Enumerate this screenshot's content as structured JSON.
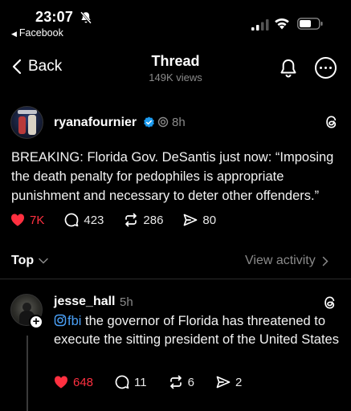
{
  "status_bar": {
    "time": "23:07",
    "back_app": "Facebook"
  },
  "nav": {
    "back_label": "Back",
    "title": "Thread",
    "subtitle": "149K views"
  },
  "post": {
    "username": "ryanafournier",
    "time": "8h",
    "text": "BREAKING: Florida Gov. DeSantis just now: “Imposing the death penalty for pedophiles is appropriate punishment and necessary to deter other offenders.”",
    "likes": "7K",
    "replies": "423",
    "reposts": "286",
    "shares": "80"
  },
  "sort": {
    "label": "Top",
    "view_activity": "View activity"
  },
  "reply": {
    "username": "jesse_hall",
    "time": "5h",
    "mention": "fbi",
    "text": " the governor of Florida has threatened to execute the sitting president of the United States",
    "likes": "648",
    "replies": "11",
    "reposts": "6",
    "shares": "2"
  },
  "colors": {
    "background": "#000000",
    "like": "#ff3040",
    "mention": "#4a9ff5",
    "verified": "#1d9bf0",
    "muted": "#8a8a8a"
  },
  "icons": [
    "bell-off-icon",
    "signal-icon",
    "wifi-icon",
    "battery-icon",
    "chevron-left-icon",
    "bell-icon",
    "more-icon",
    "verified-icon",
    "threads-logo-icon",
    "heart-icon",
    "comment-icon",
    "repost-icon",
    "share-icon",
    "chevron-down-icon",
    "chevron-right-icon",
    "instagram-icon",
    "plus-icon"
  ]
}
